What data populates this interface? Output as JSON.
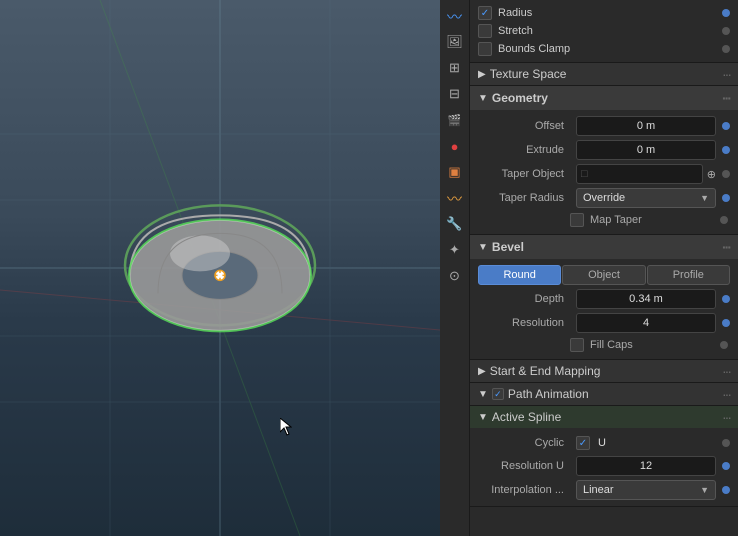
{
  "toolbar": {
    "icons": [
      {
        "name": "curves-icon",
        "glyph": "〰"
      },
      {
        "name": "image-icon",
        "glyph": "🖼"
      },
      {
        "name": "particles-icon",
        "glyph": "⊞"
      },
      {
        "name": "physics-icon",
        "glyph": "🔬"
      },
      {
        "name": "constraints-icon",
        "glyph": "🔗"
      },
      {
        "name": "modifiers-icon",
        "glyph": "🔧"
      },
      {
        "name": "shader-icon",
        "glyph": "◉"
      },
      {
        "name": "object-data-icon",
        "glyph": "〰",
        "active": true
      },
      {
        "name": "scene-icon",
        "glyph": "🌐"
      },
      {
        "name": "world-icon",
        "glyph": "🔴"
      },
      {
        "name": "render-icon",
        "glyph": "⊠"
      }
    ]
  },
  "curve_deform": {
    "radius_checked": true,
    "stretch_checked": false,
    "bounds_clamp_checked": false,
    "radius_label": "Radius",
    "stretch_label": "Stretch",
    "bounds_clamp_label": "Bounds Clamp"
  },
  "texture_space": {
    "header": "Texture Space"
  },
  "geometry": {
    "header": "Geometry",
    "offset_label": "Offset",
    "offset_value": "0 m",
    "extrude_label": "Extrude",
    "extrude_value": "0 m",
    "taper_object_label": "Taper Object",
    "taper_radius_label": "Taper Radius",
    "taper_radius_value": "Override",
    "map_taper_label": "Map Taper"
  },
  "bevel": {
    "header": "Bevel",
    "buttons": [
      {
        "label": "Round",
        "active": true
      },
      {
        "label": "Object",
        "active": false
      },
      {
        "label": "Profile",
        "active": false
      }
    ],
    "depth_label": "Depth",
    "depth_value": "0.34 m",
    "resolution_label": "Resolution",
    "resolution_value": "4",
    "fill_caps_label": "Fill Caps"
  },
  "start_end_mapping": {
    "header": "Start & End Mapping",
    "collapsed": true
  },
  "path_animation": {
    "header": "Path Animation",
    "checked": true
  },
  "active_spline": {
    "header": "Active Spline",
    "cyclic_label": "Cyclic",
    "cyclic_u_label": "U",
    "cyclic_checked": true,
    "resolution_u_label": "Resolution U",
    "resolution_u_value": "12",
    "interpolation_label": "Interpolation ...",
    "interpolation_value": "Linear"
  }
}
